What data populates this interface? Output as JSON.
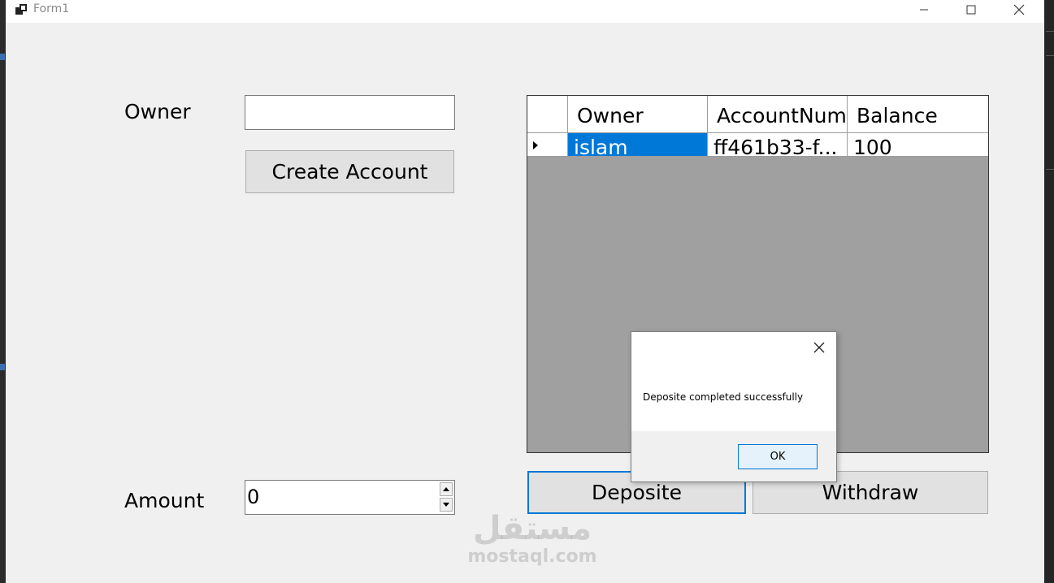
{
  "window": {
    "title": "Form1"
  },
  "form": {
    "owner_label": "Owner",
    "owner_value": "",
    "create_button": "Create Account",
    "amount_label": "Amount",
    "amount_value": "0",
    "deposit_button": "Deposite",
    "withdraw_button": "Withdraw"
  },
  "grid": {
    "columns": [
      "Owner",
      "AccountNum",
      "Balance"
    ],
    "rows": [
      {
        "owner": "islam",
        "account_num": "ff461b33-f...",
        "balance": "100"
      }
    ]
  },
  "dialog": {
    "message": "Deposite completed successfully",
    "ok_button": "OK"
  },
  "watermark": {
    "arabic": "مستقل",
    "latin": "mostaql.com"
  },
  "colors": {
    "accent": "#0078d7",
    "form_bg": "#f0f0f0",
    "grid_bg": "#a0a0a0"
  }
}
